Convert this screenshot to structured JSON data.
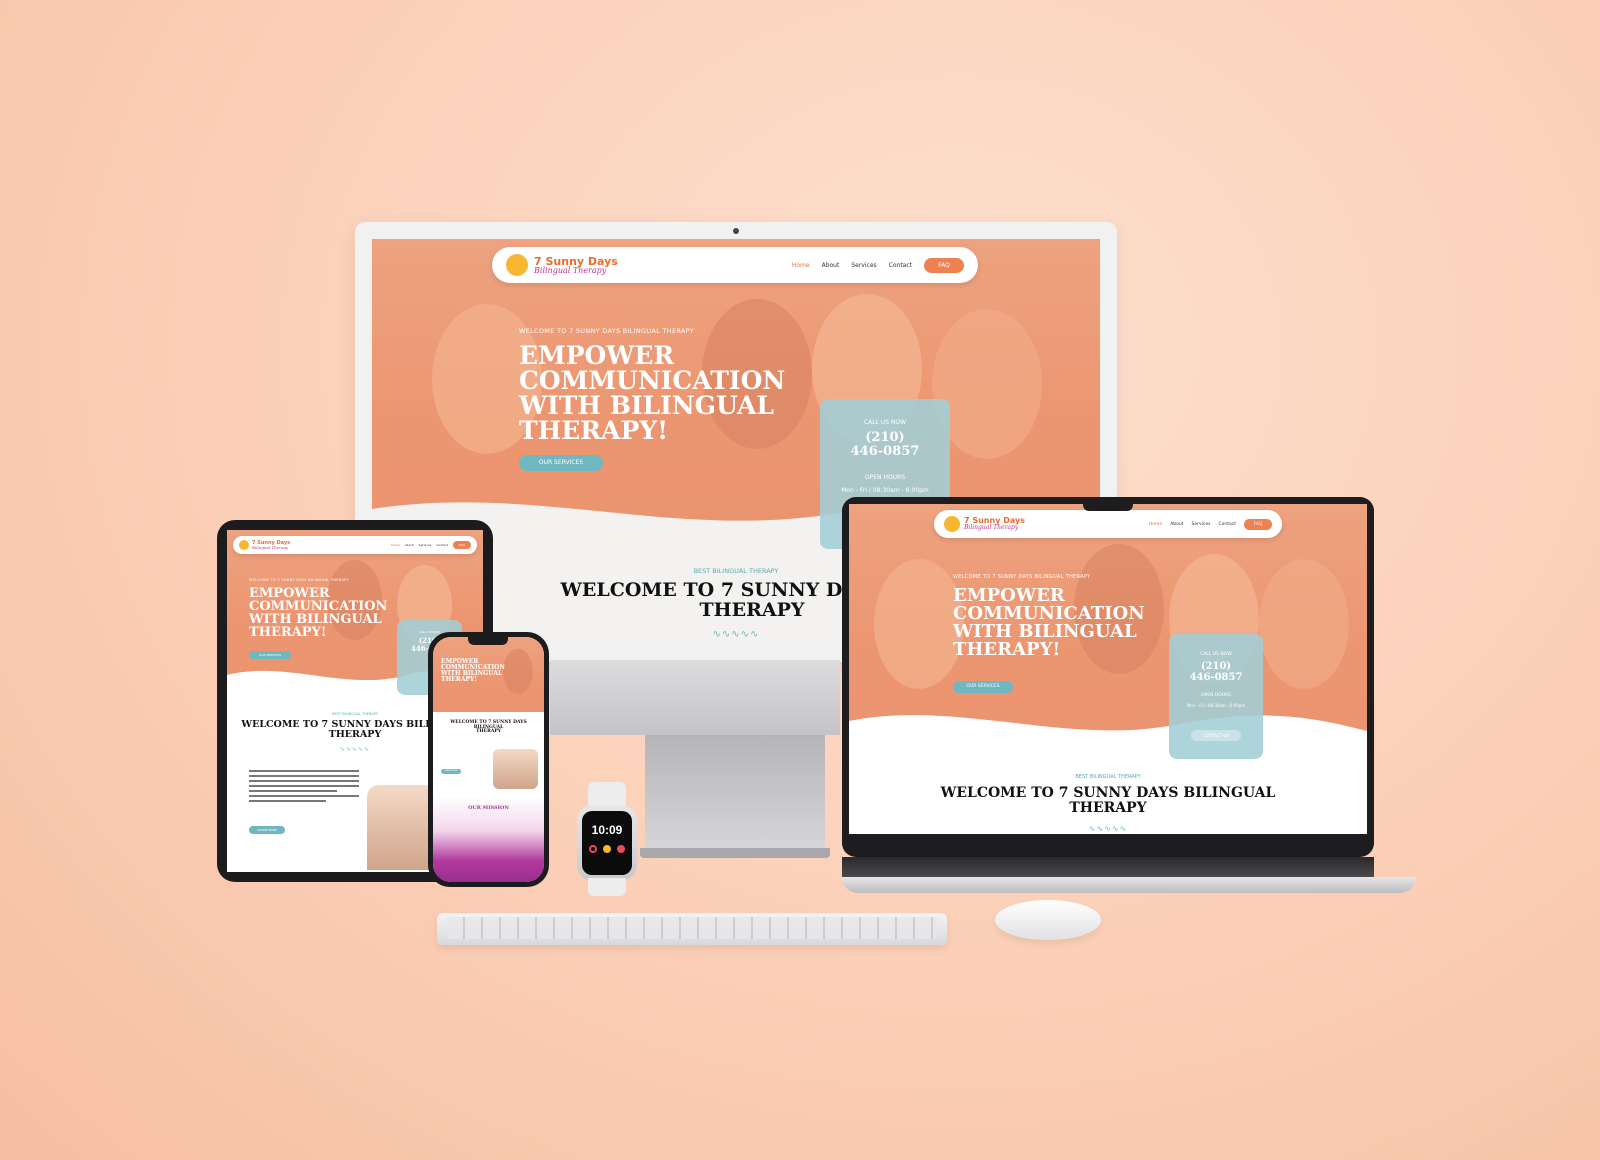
{
  "site": {
    "logo_line1": "7 Sunny Days",
    "logo_line2": "Bilingual Therapy",
    "nav": {
      "home": "Home",
      "about": "About",
      "services": "Services",
      "contact": "Contact",
      "faq": "FAQ"
    },
    "hero": {
      "eyebrow": "WELCOME TO 7 SUNNY DAYS BILINGUAL THERAPY",
      "headline_l1": "EMPOWER",
      "headline_l2": "COMMUNICATION",
      "headline_l3": "WITH BILINGUAL",
      "headline_l4": "THERAPY!",
      "cta": "OUR SERVICES"
    },
    "callbox": {
      "label": "CALL US NOW",
      "phone_l1": "(210)",
      "phone_l2": "446-0857",
      "hours_label": "OPEN HOURS",
      "hours": "Mon - Fri / 08:30am - 6:00pm",
      "contact_btn": "CONTACT US"
    },
    "section": {
      "eyebrow": "BEST BILINGUAL THERAPY",
      "title_l1": "WELCOME TO 7 SUNNY DAYS BILINGUAL",
      "title_l2": "THERAPY",
      "title_monitor_l1": "WELCOME TO 7 SUNNY DAYS",
      "squiggle": "∿∿∿∿∿"
    },
    "mobile": {
      "learn_more": "LEARN MORE",
      "mission": "OUR MISSION"
    }
  },
  "watch": {
    "time": "10:09"
  },
  "colors": {
    "background": "#fbcfb6",
    "hero_orange": "#ec9671",
    "accent_teal": "#6fb7c1",
    "faq_orange": "#ed8150",
    "mission_purple": "#a8349a"
  }
}
